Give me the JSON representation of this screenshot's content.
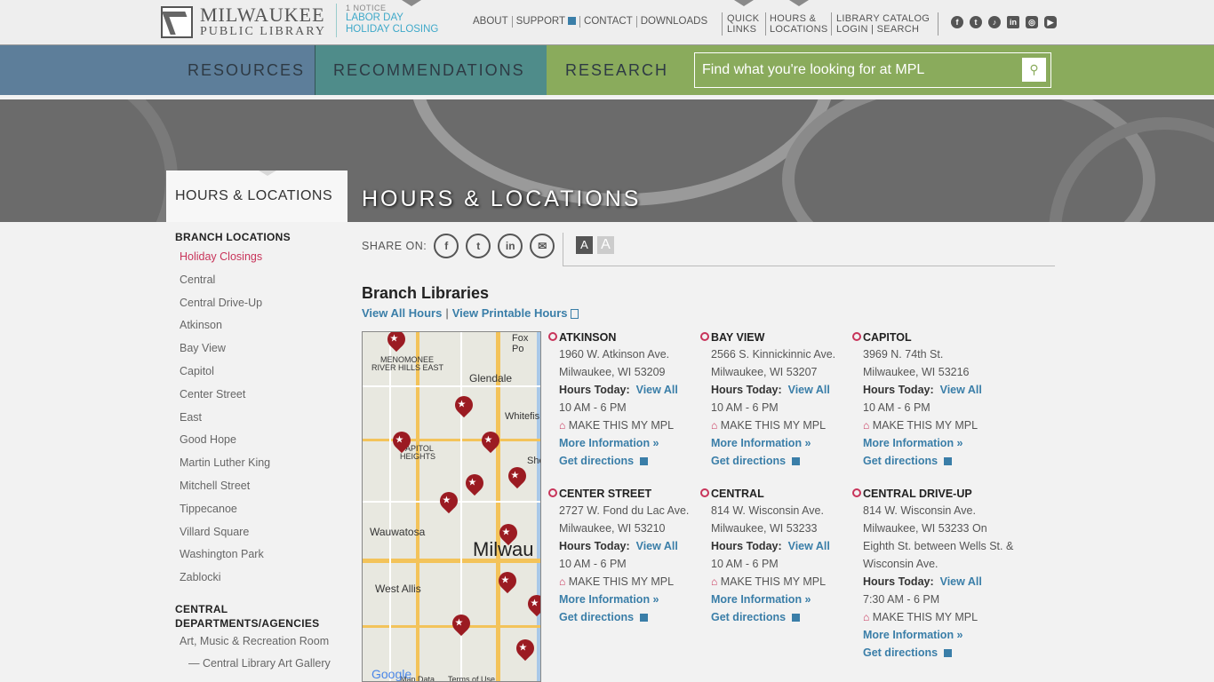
{
  "header": {
    "logo_line1": "MILWAUKEE",
    "logo_line2": "PUBLIC LIBRARY",
    "notice_count": "1 NOTICE",
    "notice_line1": "LABOR DAY",
    "notice_line2": "HOLIDAY CLOSING",
    "links": [
      "ABOUT",
      "SUPPORT",
      "CONTACT",
      "DOWNLOADS"
    ],
    "quick_links": [
      "QUICK",
      "LINKS"
    ],
    "hours_locations": [
      "HOURS &",
      "LOCATIONS"
    ],
    "catalog": [
      "LIBRARY CATALOG",
      "LOGIN",
      "SEARCH"
    ],
    "social_icons": [
      "facebook-icon",
      "twitter-icon",
      "tiktok-icon",
      "linkedin-icon",
      "instagram-icon",
      "youtube-icon"
    ]
  },
  "nav": {
    "resources": "RESOURCES",
    "recommendations": "RECOMMENDATIONS",
    "research": "RESEARCH",
    "search_placeholder": "Find what you're looking for at MPL"
  },
  "page_title": "HOURS & LOCATIONS",
  "sidebar": {
    "title": "HOURS & LOCATIONS",
    "section1": "BRANCH LOCATIONS",
    "items": [
      "Holiday Closings",
      "Central",
      "Central Drive-Up",
      "Atkinson",
      "Bay View",
      "Capitol",
      "Center Street",
      "East",
      "Good Hope",
      "Martin Luther King",
      "Mitchell Street",
      "Tippecanoe",
      "Villard Square",
      "Washington Park",
      "Zablocki"
    ],
    "section2": "CENTRAL DEPARTMENTS/AGENCIES",
    "items2": [
      "Art, Music & Recreation Room",
      "— Central Library Art Gallery"
    ]
  },
  "share": {
    "label": "SHARE ON:",
    "font_small": "A",
    "font_large": "A"
  },
  "main": {
    "heading": "Branch Libraries",
    "view_all": "View All Hours",
    "separator": "|",
    "view_printable": "View Printable Hours"
  },
  "map": {
    "labels": [
      "Fox Po",
      "MENOMONEE",
      "RIVER HILLS EAST",
      "Glendale",
      "Whitefis",
      "APITOL",
      "HEIGHTS",
      "Sho",
      "Wauwatosa",
      "Milwau",
      "West Allis",
      "Map Data",
      "Terms of Use",
      "Google"
    ]
  },
  "common": {
    "hours_today": "Hours Today:",
    "view_all": "View All",
    "make_my": "MAKE THIS MY MPL",
    "more_info": "More Information »",
    "directions": "Get directions"
  },
  "branches": [
    {
      "name": "ATKINSON",
      "addr1": "1960 W. Atkinson Ave.",
      "addr2": "Milwaukee, WI 53209",
      "hours": "10 AM - 6 PM"
    },
    {
      "name": "BAY VIEW",
      "addr1": "2566 S. Kinnickinnic Ave.",
      "addr2": "Milwaukee, WI 53207",
      "hours": "10 AM - 6 PM"
    },
    {
      "name": "CAPITOL",
      "addr1": "3969 N. 74th St.",
      "addr2": "Milwaukee, WI 53216",
      "hours": "10 AM - 6 PM"
    },
    {
      "name": "CENTER STREET",
      "addr1": "2727 W. Fond du Lac Ave.",
      "addr2": "Milwaukee, WI 53210",
      "hours": "10 AM - 6 PM"
    },
    {
      "name": "CENTRAL",
      "addr1": "814 W. Wisconsin Ave.",
      "addr2": "Milwaukee, WI 53233",
      "hours": "10 AM - 6 PM"
    },
    {
      "name": "CENTRAL DRIVE-UP",
      "addr1": "814 W. Wisconsin Ave.",
      "addr2": "Milwaukee, WI 53233 On Eighth St. between Wells St. & Wisconsin Ave.",
      "hours": "7:30 AM - 6 PM"
    }
  ]
}
